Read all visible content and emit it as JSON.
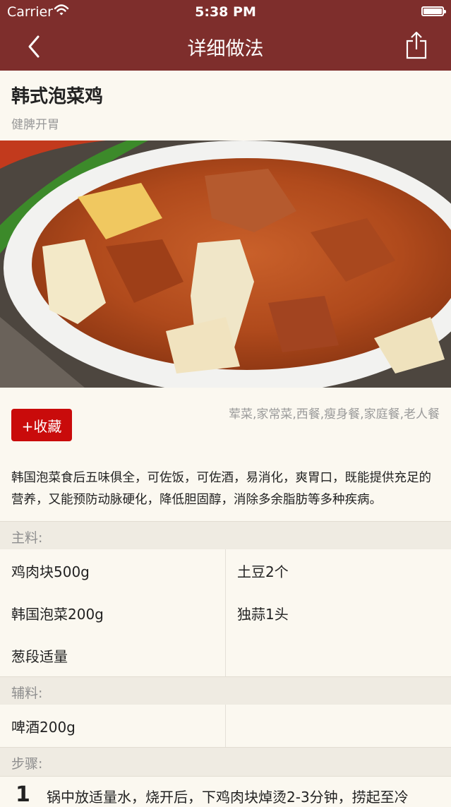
{
  "status_bar": {
    "carrier": "Carrier",
    "time": "5:38 PM"
  },
  "nav": {
    "title": "详细做法",
    "back_icon": "chevron-left-icon",
    "share_icon": "share-icon"
  },
  "recipe": {
    "name": "韩式泡菜鸡",
    "subtitle": "健脾开胃"
  },
  "favorite_label": "+收藏",
  "tags": "荤菜,家常菜,西餐,瘦身餐,家庭餐,老人餐",
  "description": "韩国泡菜食后五味俱全，可佐饭，可佐酒，易消化，爽胃口，既能提供充足的营养，又能预防动脉硬化，降低胆固醇，消除多余脂肪等多种疾病。",
  "main_ingredients": {
    "label": "主料:",
    "items": [
      "鸡肉块500g",
      "土豆2个",
      "韩国泡菜200g",
      "独蒜1头",
      "葱段适量"
    ]
  },
  "aux_ingredients": {
    "label": "辅料:",
    "items": [
      "啤酒200g"
    ]
  },
  "steps": {
    "label": "步骤:",
    "items": [
      {
        "num": "1",
        "text": "锅中放适量水，烧开后，下鸡肉块焯烫2-3分钟，捞起至冷"
      }
    ]
  },
  "colors": {
    "nav_bg": "#7e2e2c",
    "accent": "#c90b0b",
    "page_bg": "#fbf8f0",
    "section_bg": "#efebe2"
  }
}
